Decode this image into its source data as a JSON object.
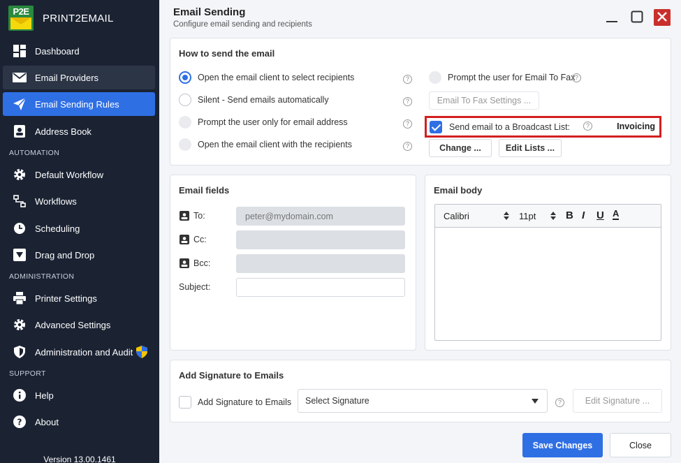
{
  "sidebar": {
    "brand_logo_text": "P2E",
    "brand_name": "PRINT2EMAIL",
    "items": [
      {
        "label": "Dashboard",
        "icon": "dashboard-icon"
      },
      {
        "label": "Email Providers",
        "icon": "envelope-icon"
      },
      {
        "label": "Email Sending Rules",
        "icon": "paper-plane-icon",
        "active": true
      },
      {
        "label": "Address Book",
        "icon": "contact-card-icon"
      },
      {
        "label": "Default Workflow",
        "icon": "gear-icon"
      },
      {
        "label": "Workflows",
        "icon": "workflow-icon"
      },
      {
        "label": "Scheduling",
        "icon": "clock-icon"
      },
      {
        "label": "Drag and Drop",
        "icon": "dropdown-triangle-icon"
      },
      {
        "label": "Printer Settings",
        "icon": "printer-icon"
      },
      {
        "label": "Advanced Settings",
        "icon": "gear-icon"
      },
      {
        "label": "Administration and Audit",
        "icon": "shield-icon"
      },
      {
        "label": "Help",
        "icon": "info-icon"
      },
      {
        "label": "About",
        "icon": "question-icon"
      }
    ],
    "sections": {
      "automation": "AUTOMATION",
      "administration": "ADMINISTRATION",
      "support": "SUPPORT"
    },
    "version": "Version 13.00.1461"
  },
  "header": {
    "title": "Email Sending",
    "subtitle": "Configure email sending and recipients"
  },
  "how_to_send": {
    "title": "How to send the email",
    "options": [
      {
        "label": "Open the email client to select recipients",
        "state": "selected"
      },
      {
        "label": "Silent - Send emails automatically",
        "state": "enabled"
      },
      {
        "label": "Prompt the user only for email address",
        "state": "disabled"
      },
      {
        "label": "Open the email client with the recipients",
        "state": "disabled"
      }
    ],
    "fax_label": "Prompt the user for Email To Fax",
    "fax_settings_button": "Email To Fax Settings ...",
    "broadcast_label": "Send email to a Broadcast List:",
    "broadcast_checked": true,
    "broadcast_list": "Invoicing",
    "change_button": "Change ...",
    "edit_lists_button": "Edit Lists ..."
  },
  "email_fields": {
    "title": "Email fields",
    "to_label": "To:",
    "to_value": "peter@mydomain.com",
    "cc_label": "Cc:",
    "cc_value": "",
    "bcc_label": "Bcc:",
    "bcc_value": "",
    "subject_label": "Subject:",
    "subject_value": ""
  },
  "email_body": {
    "title": "Email body",
    "font": "Calibri",
    "size": "11pt",
    "format_bold": "B",
    "format_italic": "I",
    "format_underline": "U",
    "format_color": "A"
  },
  "signature": {
    "title": "Add Signature to Emails",
    "checkbox_label": "Add Signature to Emails",
    "select_placeholder": "Select Signature",
    "edit_button": "Edit Signature ..."
  },
  "footer": {
    "save_button": "Save Changes",
    "close_button": "Close"
  },
  "colors": {
    "sidebar_bg": "#1b2333",
    "accent": "#2f6fe4",
    "highlight_border": "#d21f1f",
    "close_button": "#c9302c"
  }
}
